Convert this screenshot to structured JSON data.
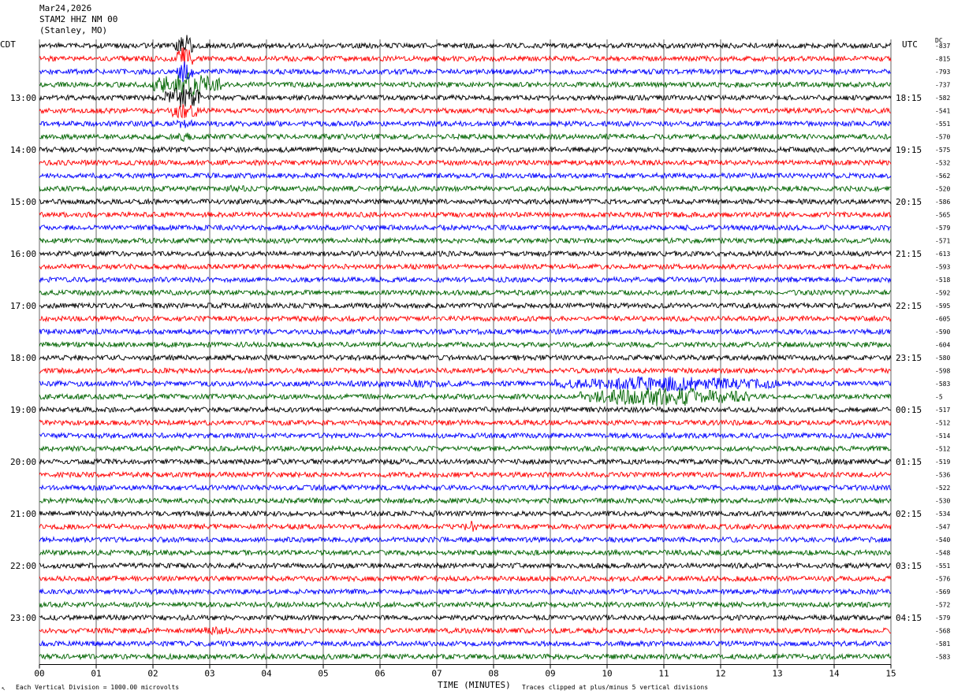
{
  "header": {
    "date": "Mar24,2026",
    "station": "STAM2 HHZ NM 00",
    "location": "(Stanley, MO)"
  },
  "labels": {
    "left_tz": "CDT",
    "right_tz": "UTC",
    "dc": "DC",
    "footer_left": "Each Vertical Division = 1000.00 microvolts",
    "footer_right": "Traces clipped at plus/minus 5 vertical divisions",
    "corner_mark": "↖"
  },
  "colors": {
    "trace_cycle": [
      "#000000",
      "#ff0000",
      "#0000ff",
      "#006400"
    ],
    "grid": "#000000"
  },
  "chart_data": {
    "type": "line",
    "xlabel": "TIME (MINUTES)",
    "x_ticks": [
      "00",
      "01",
      "02",
      "03",
      "04",
      "05",
      "06",
      "07",
      "08",
      "09",
      "10",
      "11",
      "12",
      "13",
      "14",
      "15"
    ],
    "xlim": [
      0,
      15
    ],
    "rows_per_hour": 4,
    "left_hour_labels": [
      "13:00",
      "14:00",
      "15:00",
      "16:00",
      "17:00",
      "18:00",
      "19:00",
      "20:00",
      "21:00",
      "22:00",
      "23:00"
    ],
    "right_hour_labels": [
      "18:15",
      "19:15",
      "20:15",
      "21:15",
      "22:15",
      "23:15",
      "00:15",
      "01:15",
      "02:15",
      "03:15",
      "04:15"
    ],
    "dc_offsets": [
      "-837",
      "-815",
      "-793",
      "-737",
      "-582",
      "-541",
      "-551",
      "-570",
      "-575",
      "-532",
      "-562",
      "-520",
      "-586",
      "-565",
      "-579",
      "-571",
      "-613",
      "-593",
      "-518",
      "-592",
      "-595",
      "-605",
      "-590",
      "-604",
      "-580",
      "-598",
      "-583",
      "-5",
      "-517",
      "-512",
      "-514",
      "-512",
      "-519",
      "-536",
      "-522",
      "-530",
      "-534",
      "-547",
      "-540",
      "-548",
      "-551",
      "-576",
      "-569",
      "-572",
      "-579",
      "-568",
      "-581",
      "-583"
    ],
    "events": [
      {
        "row": 0,
        "start_min": 2.4,
        "end_min": 2.7,
        "amp": 5
      },
      {
        "row": 1,
        "start_min": 2.4,
        "end_min": 2.7,
        "amp": 5
      },
      {
        "row": 2,
        "start_min": 2.4,
        "end_min": 2.7,
        "amp": 5
      },
      {
        "row": 3,
        "start_min": 2.0,
        "end_min": 3.2,
        "amp": 5
      },
      {
        "row": 4,
        "start_min": 2.2,
        "end_min": 2.9,
        "amp": 5
      },
      {
        "row": 5,
        "start_min": 2.3,
        "end_min": 2.8,
        "amp": 4
      },
      {
        "row": 6,
        "start_min": 2.4,
        "end_min": 2.7,
        "amp": 2
      },
      {
        "row": 7,
        "start_min": 2.4,
        "end_min": 2.7,
        "amp": 2
      },
      {
        "row": 11,
        "start_min": 3.3,
        "end_min": 3.7,
        "amp": 1.5
      },
      {
        "row": 26,
        "start_min": 5.5,
        "end_min": 7.5,
        "amp": 1.5
      },
      {
        "row": 26,
        "start_min": 9.0,
        "end_min": 13.0,
        "amp": 3
      },
      {
        "row": 27,
        "start_min": 0.0,
        "end_min": 15.0,
        "amp": 1
      },
      {
        "row": 27,
        "start_min": 9.5,
        "end_min": 12.5,
        "amp": 4
      },
      {
        "row": 28,
        "start_min": 0.0,
        "end_min": 6.0,
        "amp": 1
      },
      {
        "row": 36,
        "start_min": 6.85,
        "end_min": 7.0,
        "amp": 1.6
      },
      {
        "row": 37,
        "start_min": 7.5,
        "end_min": 7.7,
        "amp": 2.5
      },
      {
        "row": 45,
        "start_min": 2.7,
        "end_min": 3.4,
        "amp": 1.6
      }
    ]
  }
}
